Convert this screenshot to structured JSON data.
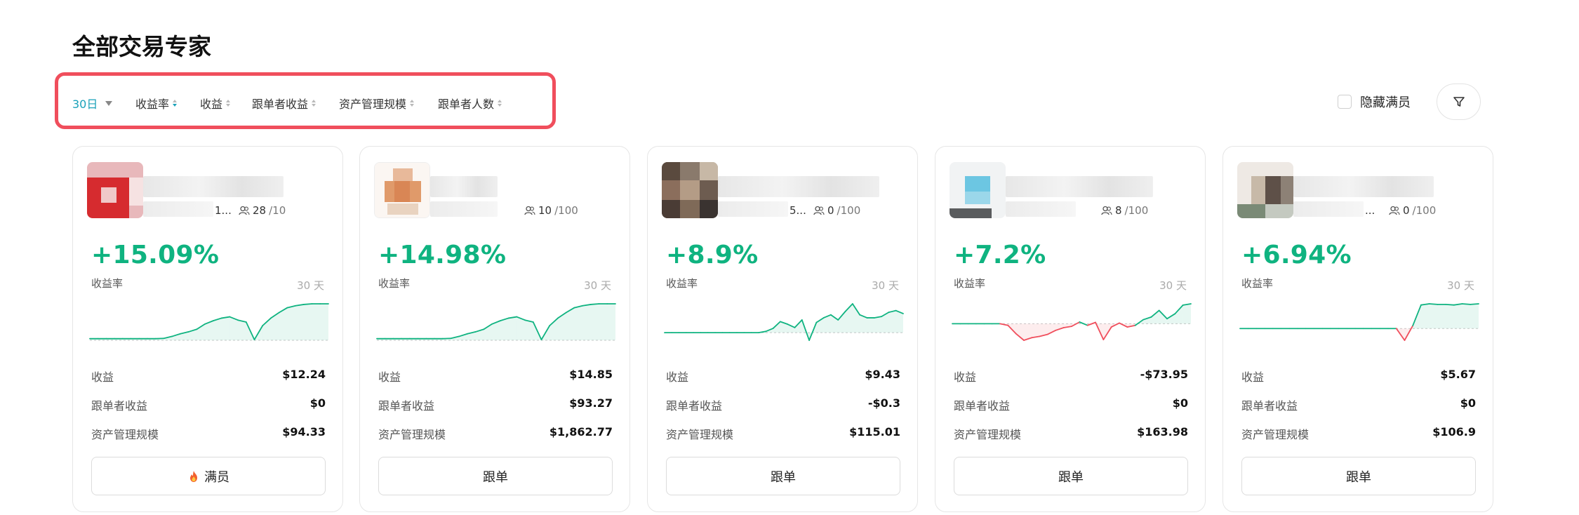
{
  "page_title": "全部交易专家",
  "filters": {
    "period": "30日",
    "sort_options": [
      "收益率",
      "收益",
      "跟单者收益",
      "资产管理规模",
      "跟单者人数"
    ]
  },
  "hide_full_label": "隐藏满员",
  "icons": {
    "filter": "filter-funnel-icon",
    "followers": "users-icon",
    "flame": "flame-icon"
  },
  "colors": {
    "accent": "#1aa1b9",
    "positive": "#0fb380",
    "negative": "#f04e5c",
    "highlight_border": "#f04e5c"
  },
  "cards": [
    {
      "name_fragment": "1...",
      "followers": "28",
      "followers_total": "/10",
      "roi": "+15.09%",
      "roi_label": "收益率",
      "period": "30 天",
      "sparkline": [
        0.5,
        0.5,
        0.5,
        0.5,
        0.5,
        0.5,
        0.5,
        0.5,
        0.5,
        0.6,
        1.2,
        2.0,
        2.6,
        3.4,
        5.0,
        6.0,
        6.8,
        7.2,
        6.2,
        5.6,
        0.2,
        4.5,
        6.8,
        8.5,
        10.0,
        10.6,
        11.0,
        11.2,
        11.2,
        11.2
      ],
      "stats": [
        {
          "label": "收益",
          "value": "$12.24"
        },
        {
          "label": "跟单者收益",
          "value": "$0"
        },
        {
          "label": "资产管理规模",
          "value": "$94.33"
        }
      ],
      "action": "满员"
    },
    {
      "name_fragment": "",
      "followers": "10",
      "followers_total": "/100",
      "roi": "+14.98%",
      "roi_label": "收益率",
      "period": "30 天",
      "sparkline": [
        0.5,
        0.5,
        0.5,
        0.5,
        0.5,
        0.5,
        0.5,
        0.5,
        0.5,
        0.6,
        1.2,
        2.0,
        2.6,
        3.4,
        5.0,
        6.0,
        6.8,
        7.2,
        6.2,
        5.6,
        0.2,
        4.5,
        6.8,
        8.5,
        10.0,
        10.6,
        11.0,
        11.2,
        11.2,
        11.2
      ],
      "stats": [
        {
          "label": "收益",
          "value": "$14.85"
        },
        {
          "label": "跟单者收益",
          "value": "$93.27"
        },
        {
          "label": "资产管理规模",
          "value": "$1,862.77"
        }
      ],
      "action": "跟单"
    },
    {
      "name_fragment": "5...",
      "followers": "0",
      "followers_total": "/100",
      "roi": "+8.9%",
      "roi_label": "收益率",
      "period": "30 天",
      "sparkline": [
        0,
        0,
        0,
        0,
        0,
        0,
        0,
        0,
        0,
        0,
        0,
        0,
        0,
        0,
        0.3,
        1.0,
        2.6,
        2.0,
        1.2,
        3.0,
        -1.8,
        2.4,
        3.5,
        4.2,
        3.0,
        5.0,
        6.8,
        4.2,
        3.5,
        3.5,
        3.8,
        4.8,
        5.2,
        4.5
      ],
      "stats": [
        {
          "label": "收益",
          "value": "$9.43"
        },
        {
          "label": "跟单者收益",
          "value": "-$0.3"
        },
        {
          "label": "资产管理规模",
          "value": "$115.01"
        }
      ],
      "action": "跟单"
    },
    {
      "name_fragment": "",
      "followers": "8",
      "followers_total": "/100",
      "roi": "+7.2%",
      "roi_label": "收益率",
      "period": "30 天",
      "sparkline": [
        0,
        0,
        0,
        0,
        0,
        0,
        0,
        -0.5,
        -3.0,
        -5.0,
        -4.2,
        -3.8,
        -3.2,
        -2.0,
        -1.2,
        -0.8,
        0.5,
        -0.5,
        0.4,
        -4.8,
        -1.0,
        0.2,
        -1.0,
        -0.5,
        1.2,
        2.0,
        4.0,
        1.5,
        3.0,
        5.6,
        6.0
      ],
      "stats": [
        {
          "label": "收益",
          "value": "-$73.95"
        },
        {
          "label": "跟单者收益",
          "value": "$0"
        },
        {
          "label": "资产管理规模",
          "value": "$163.98"
        }
      ],
      "action": "跟单"
    },
    {
      "name_fragment": "...",
      "followers": "0",
      "followers_total": "/100",
      "roi": "+6.94%",
      "roi_label": "收益率",
      "period": "30 天",
      "sparkline": [
        0,
        0,
        0,
        0,
        0,
        0,
        0,
        0,
        0,
        0,
        0,
        0,
        0,
        0,
        0,
        0,
        0,
        0,
        0,
        0,
        -2.0,
        0.5,
        4.0,
        4.2,
        4.1,
        4.1,
        4.0,
        4.2,
        4.1,
        4.2
      ],
      "stats": [
        {
          "label": "收益",
          "value": "$5.67"
        },
        {
          "label": "跟单者收益",
          "value": "$0"
        },
        {
          "label": "资产管理规模",
          "value": "$106.9"
        }
      ],
      "action": "跟单"
    }
  ]
}
